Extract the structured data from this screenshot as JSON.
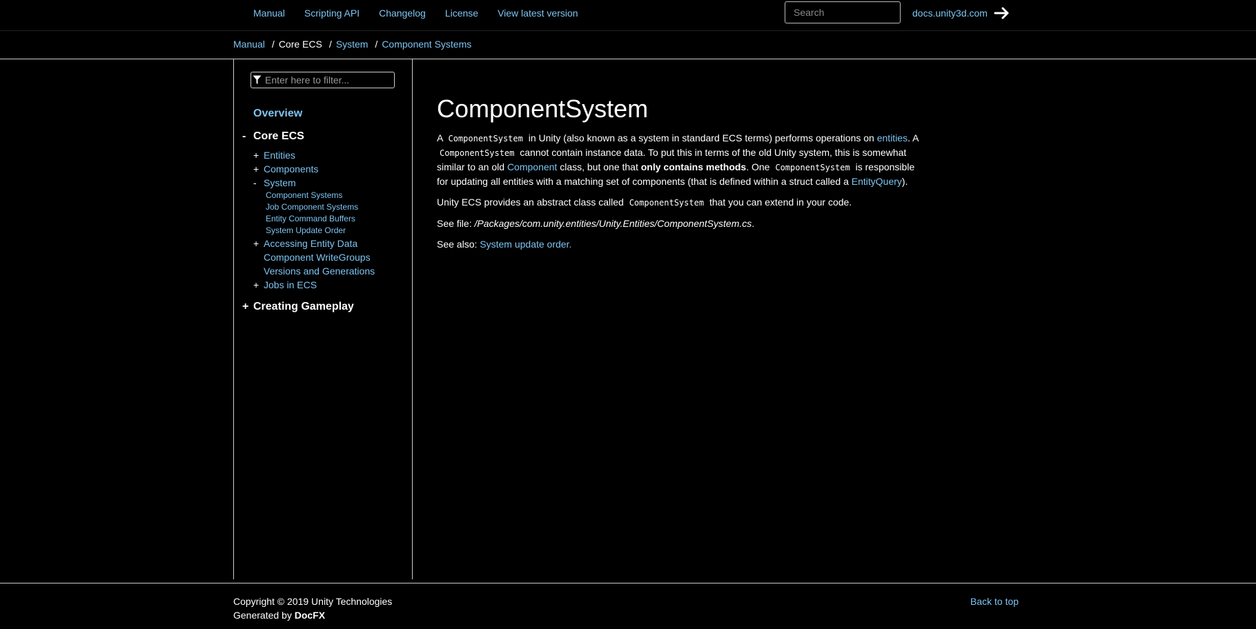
{
  "topnav": {
    "items": [
      "Manual",
      "Scripting API",
      "Changelog",
      "License",
      "View latest version"
    ],
    "search_placeholder": "Search",
    "docs_link": "docs.unity3d.com"
  },
  "breadcrumb": {
    "items": [
      "Manual",
      "Core ECS",
      "System",
      "Component Systems"
    ],
    "separator": "/"
  },
  "sidebar": {
    "filter_placeholder": "Enter here to filter...",
    "overview": "Overview",
    "core_ecs": {
      "toggle": "-",
      "label": "Core ECS"
    },
    "children": [
      {
        "toggle": "+",
        "label": "Entities"
      },
      {
        "toggle": "+",
        "label": "Components"
      },
      {
        "toggle": "-",
        "label": "System"
      }
    ],
    "system_children": [
      "Component Systems",
      "Job Component Systems",
      "Entity Command Buffers",
      "System Update Order"
    ],
    "more": [
      {
        "toggle": "+",
        "label": "Accessing Entity Data"
      },
      {
        "toggle": "",
        "label": "Component WriteGroups"
      },
      {
        "toggle": "",
        "label": "Versions and Generations"
      },
      {
        "toggle": "+",
        "label": "Jobs in ECS"
      }
    ],
    "creating_gameplay": {
      "toggle": "+",
      "label": "Creating Gameplay"
    }
  },
  "article": {
    "title": "ComponentSystem",
    "p1": {
      "a": "A",
      "code1": "ComponentSystem",
      "b": "in Unity (also known as a system in standard ECS terms) performs operations on",
      "link_entities": "entities",
      "c": ". A",
      "code2": "ComponentSystem",
      "d": "cannot contain instance data. To put this in terms of the old Unity system, this is somewhat similar to an old",
      "link_component": "Component",
      "e": "class, but one that",
      "bold": "only contains methods",
      "f": ". One",
      "code3": "ComponentSystem",
      "g": "is responsible for updating all entities with a matching set of components (that is defined within a struct called a",
      "link_query": "EntityQuery",
      "h": ")."
    },
    "p2": {
      "a": "Unity ECS provides an abstract class called",
      "code": "ComponentSystem",
      "b": "that you can extend in your code."
    },
    "p3": {
      "label": "See file:",
      "path": "/Packages/com.unity.entities/Unity.Entities/ComponentSystem.cs",
      "end": "."
    },
    "p4": {
      "label": "See also:",
      "link": "System update order",
      "end": "."
    }
  },
  "footer": {
    "copyright": "Copyright © 2019 Unity Technologies",
    "generated_by": "Generated by",
    "generator": "DocFX",
    "back_to_top": "Back to top"
  }
}
